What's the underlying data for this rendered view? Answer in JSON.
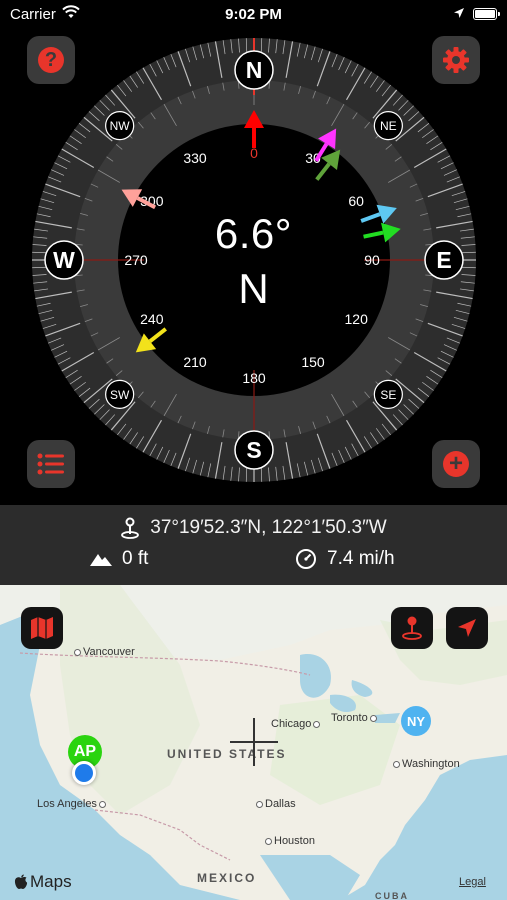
{
  "status_bar": {
    "carrier": "Carrier",
    "time": "9:02 PM"
  },
  "compass": {
    "heading": "6.6°",
    "heading_direction": "N",
    "cardinals": [
      "N",
      "E",
      "S",
      "W"
    ],
    "intercardinals": [
      "NE",
      "SE",
      "SW",
      "NW"
    ],
    "degree_labels": [
      "0",
      "30",
      "60",
      "90",
      "120",
      "150",
      "180",
      "210",
      "240",
      "270",
      "300",
      "330"
    ],
    "accent_color": "#e8352b",
    "arrow_colors": [
      "#ff0000",
      "#ff33ff",
      "#5fa33a",
      "#5ec8f2",
      "#22dd22",
      "#ffa19a",
      "#f2e21b"
    ]
  },
  "info": {
    "coordinates": "37°19′52.3″N, 122°1′50.3″W",
    "altitude": "0 ft",
    "speed": "7.4 mi/h"
  },
  "map": {
    "labels": {
      "vancouver": "Vancouver",
      "chicago": "Chicago",
      "toronto": "Toronto",
      "washington": "Washington",
      "los_angeles": "Los Angeles",
      "dallas": "Dallas",
      "houston": "Houston",
      "country_us": "UNITED STATES",
      "country_mx": "MEXICO",
      "cuba": "CUBA"
    },
    "markers": {
      "ap": "AP",
      "ny": "NY"
    },
    "attribution": "Maps",
    "legal": "Legal"
  }
}
